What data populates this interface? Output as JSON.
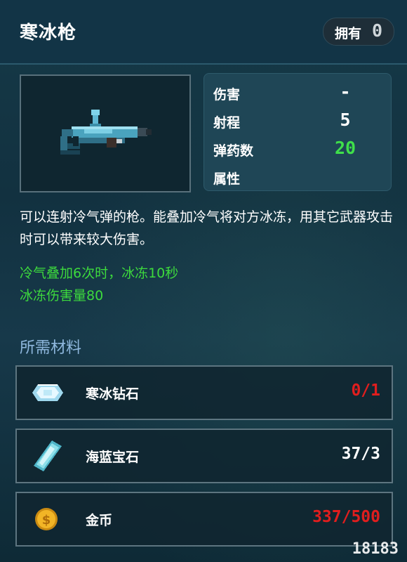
{
  "header": {
    "title": "寒冰枪",
    "owned_label": "拥有",
    "owned_count": "0"
  },
  "stats": [
    {
      "label": "伤害",
      "value": "-",
      "color": "#ffffff"
    },
    {
      "label": "射程",
      "value": "5",
      "color": "#ffffff"
    },
    {
      "label": "弹药数",
      "value": "20",
      "color": "#3fe04a"
    },
    {
      "label": "属性",
      "value": "",
      "color": "#ffffff"
    }
  ],
  "description": "可以连射冷气弹的枪。能叠加冷气将对方冰冻，用其它武器攻击时可以带来较大伤害。",
  "effects": [
    "冷气叠加6次时，冰冻10秒",
    "冰冻伤害量80"
  ],
  "materials_title": "所需材料",
  "materials": [
    {
      "name": "寒冰钻石",
      "quantity": "0/1",
      "qty_color": "#e01e1e",
      "icon": "ice-diamond-icon"
    },
    {
      "name": "海蓝宝石",
      "quantity": "37/3",
      "qty_color": "#ffffff",
      "icon": "aquamarine-icon"
    },
    {
      "name": "金币",
      "quantity": "337/500",
      "qty_color": "#e01e1e",
      "icon": "gold-coin-icon"
    }
  ],
  "watermark": "18183",
  "colors": {
    "effect_green": "#3dda3d",
    "section_title": "#8fb8de",
    "insufficient_red": "#e01e1e"
  }
}
